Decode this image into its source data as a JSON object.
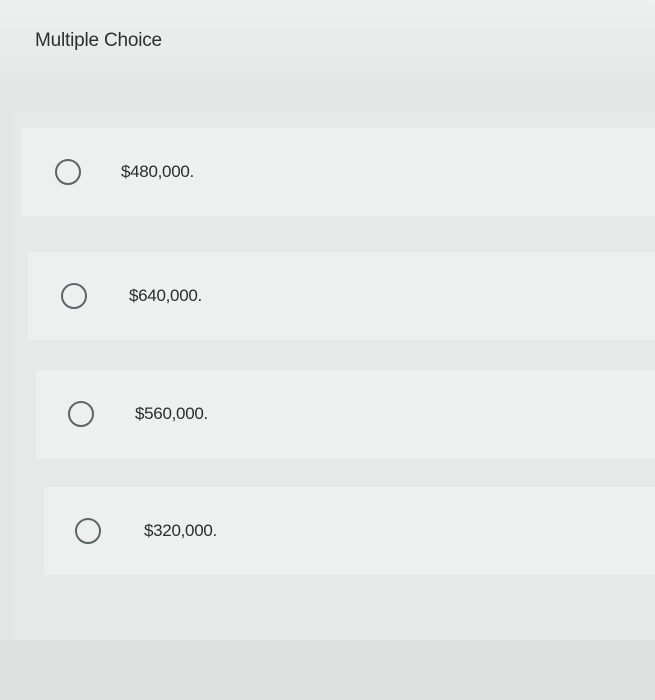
{
  "question": {
    "title": "Multiple Choice"
  },
  "options": [
    {
      "label": "$480,000."
    },
    {
      "label": "$640,000."
    },
    {
      "label": "$560,000."
    },
    {
      "label": "$320,000."
    }
  ],
  "colors": {
    "background": "#e4e6e5",
    "option_background": "#eef0ef",
    "radio_border": "#5f6466",
    "text": "#2b2d2e"
  },
  "icons": {
    "radio": "radio-unselected-icon"
  }
}
